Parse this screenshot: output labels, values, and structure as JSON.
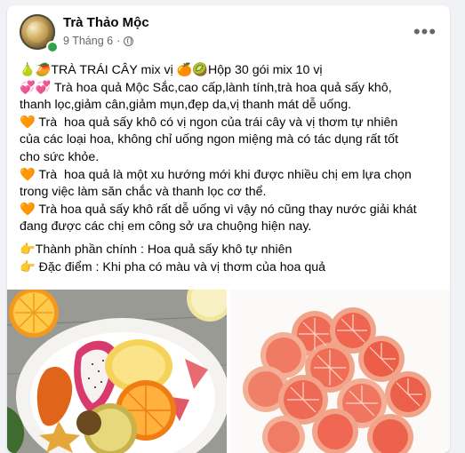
{
  "post": {
    "author": "Trà Thảo Mộc",
    "date": "9 Tháng 6",
    "separator": "·",
    "more_label": "•••",
    "lines": [
      "🍐🥭TRÀ TRÁI CÂY mix vị 🍊🥝Hộp 30 gói mix 10 vị",
      "💞💞 Trà hoa quả Mộc Sắc,cao cấp,lành tính,trà hoa quả sấy khô,",
      "thanh lọc,giảm cân,giảm mụn,đẹp da,vị thanh mát dễ uống.",
      "🧡 Trà  hoa quả sấy khô có vị ngon của trái cây và vị thơm tự nhiên",
      "của các loại hoa, không chỉ uống ngon miệng mà có tác dụng rất tốt",
      "cho sức khỏe.",
      "🧡 Trà  hoa quả là một xu hướng mới khi được nhiều chị em lựa chọn",
      "trong việc làm săn chắc và thanh lọc cơ thể.",
      "🧡 Trà hoa quả sấy khô rất dễ uống vì vậy nó cũng thay nước giải khát",
      "đang được các chị em công sở ưa chuộng hiện nay."
    ],
    "features": [
      "👉Thành phần chính : Hoa quả sấy khô tự nhiên",
      "👉 Đặc điểm : Khi pha có màu và vị thơm của hoa quả"
    ]
  },
  "colors": {
    "background": "#f0f2f5",
    "card": "#ffffff",
    "text": "#050505",
    "secondary": "#65676b",
    "online": "#31a24c"
  },
  "icons": [
    "globe-icon",
    "more-options-icon",
    "online-status-icon"
  ]
}
